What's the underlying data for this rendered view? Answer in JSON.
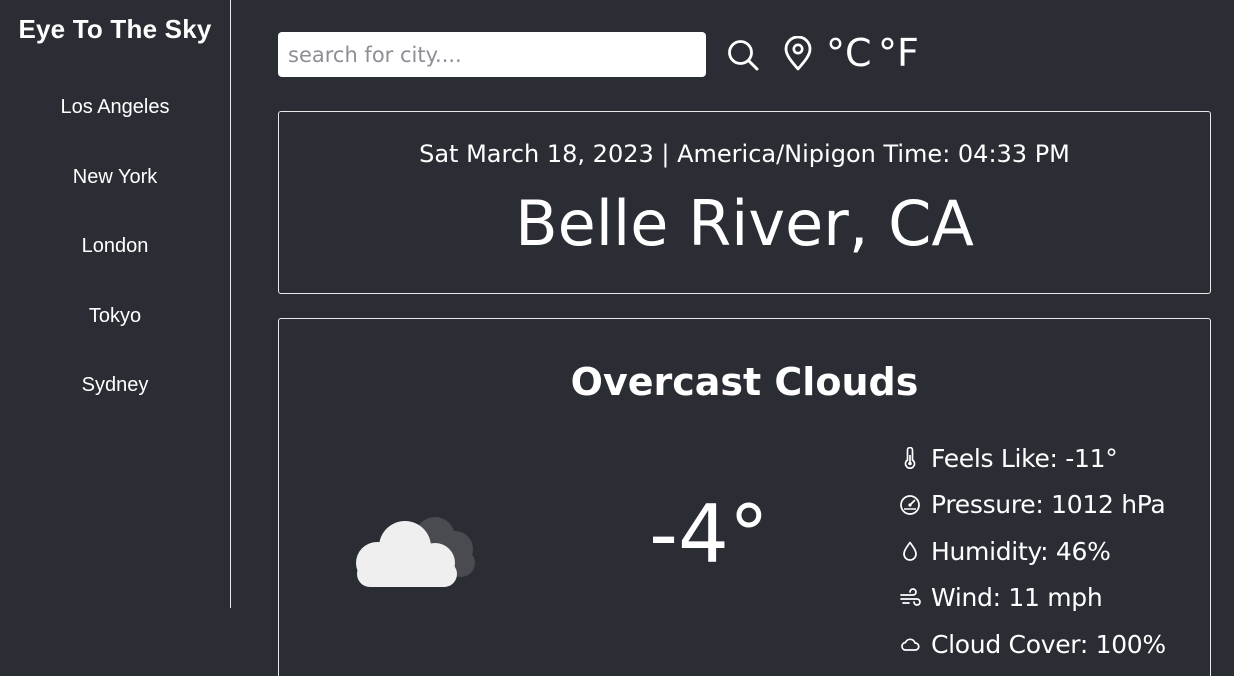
{
  "sidebar": {
    "brand": "Eye To The Sky",
    "cities": [
      "Los Angeles",
      "New York",
      "London",
      "Tokyo",
      "Sydney"
    ]
  },
  "search": {
    "placeholder": "search for city....",
    "value": ""
  },
  "units": {
    "celsius": "°C",
    "fahrenheit": "°F"
  },
  "header": {
    "datetime": "Sat March 18, 2023 | America/Nipigon Time: 04:33 PM",
    "city": "Belle River, CA"
  },
  "weather": {
    "condition": "Overcast Clouds",
    "temperature": "-4°",
    "stats": {
      "feels_like": "Feels Like: -11°",
      "pressure": "Pressure: 1012 hPa",
      "humidity": "Humidity: 46%",
      "wind": "Wind: 11 mph",
      "cloud_cover": "Cloud Cover: 100%"
    },
    "icons": {
      "condition": "overcast-cloud-icon",
      "feels_like": "thermometer-icon",
      "pressure": "gauge-icon",
      "humidity": "droplet-icon",
      "wind": "wind-icon",
      "cloud_cover": "cloud-icon"
    }
  },
  "colors": {
    "background": "#2b2d34",
    "foreground": "#ffffff",
    "border": "#e9e9e9"
  }
}
